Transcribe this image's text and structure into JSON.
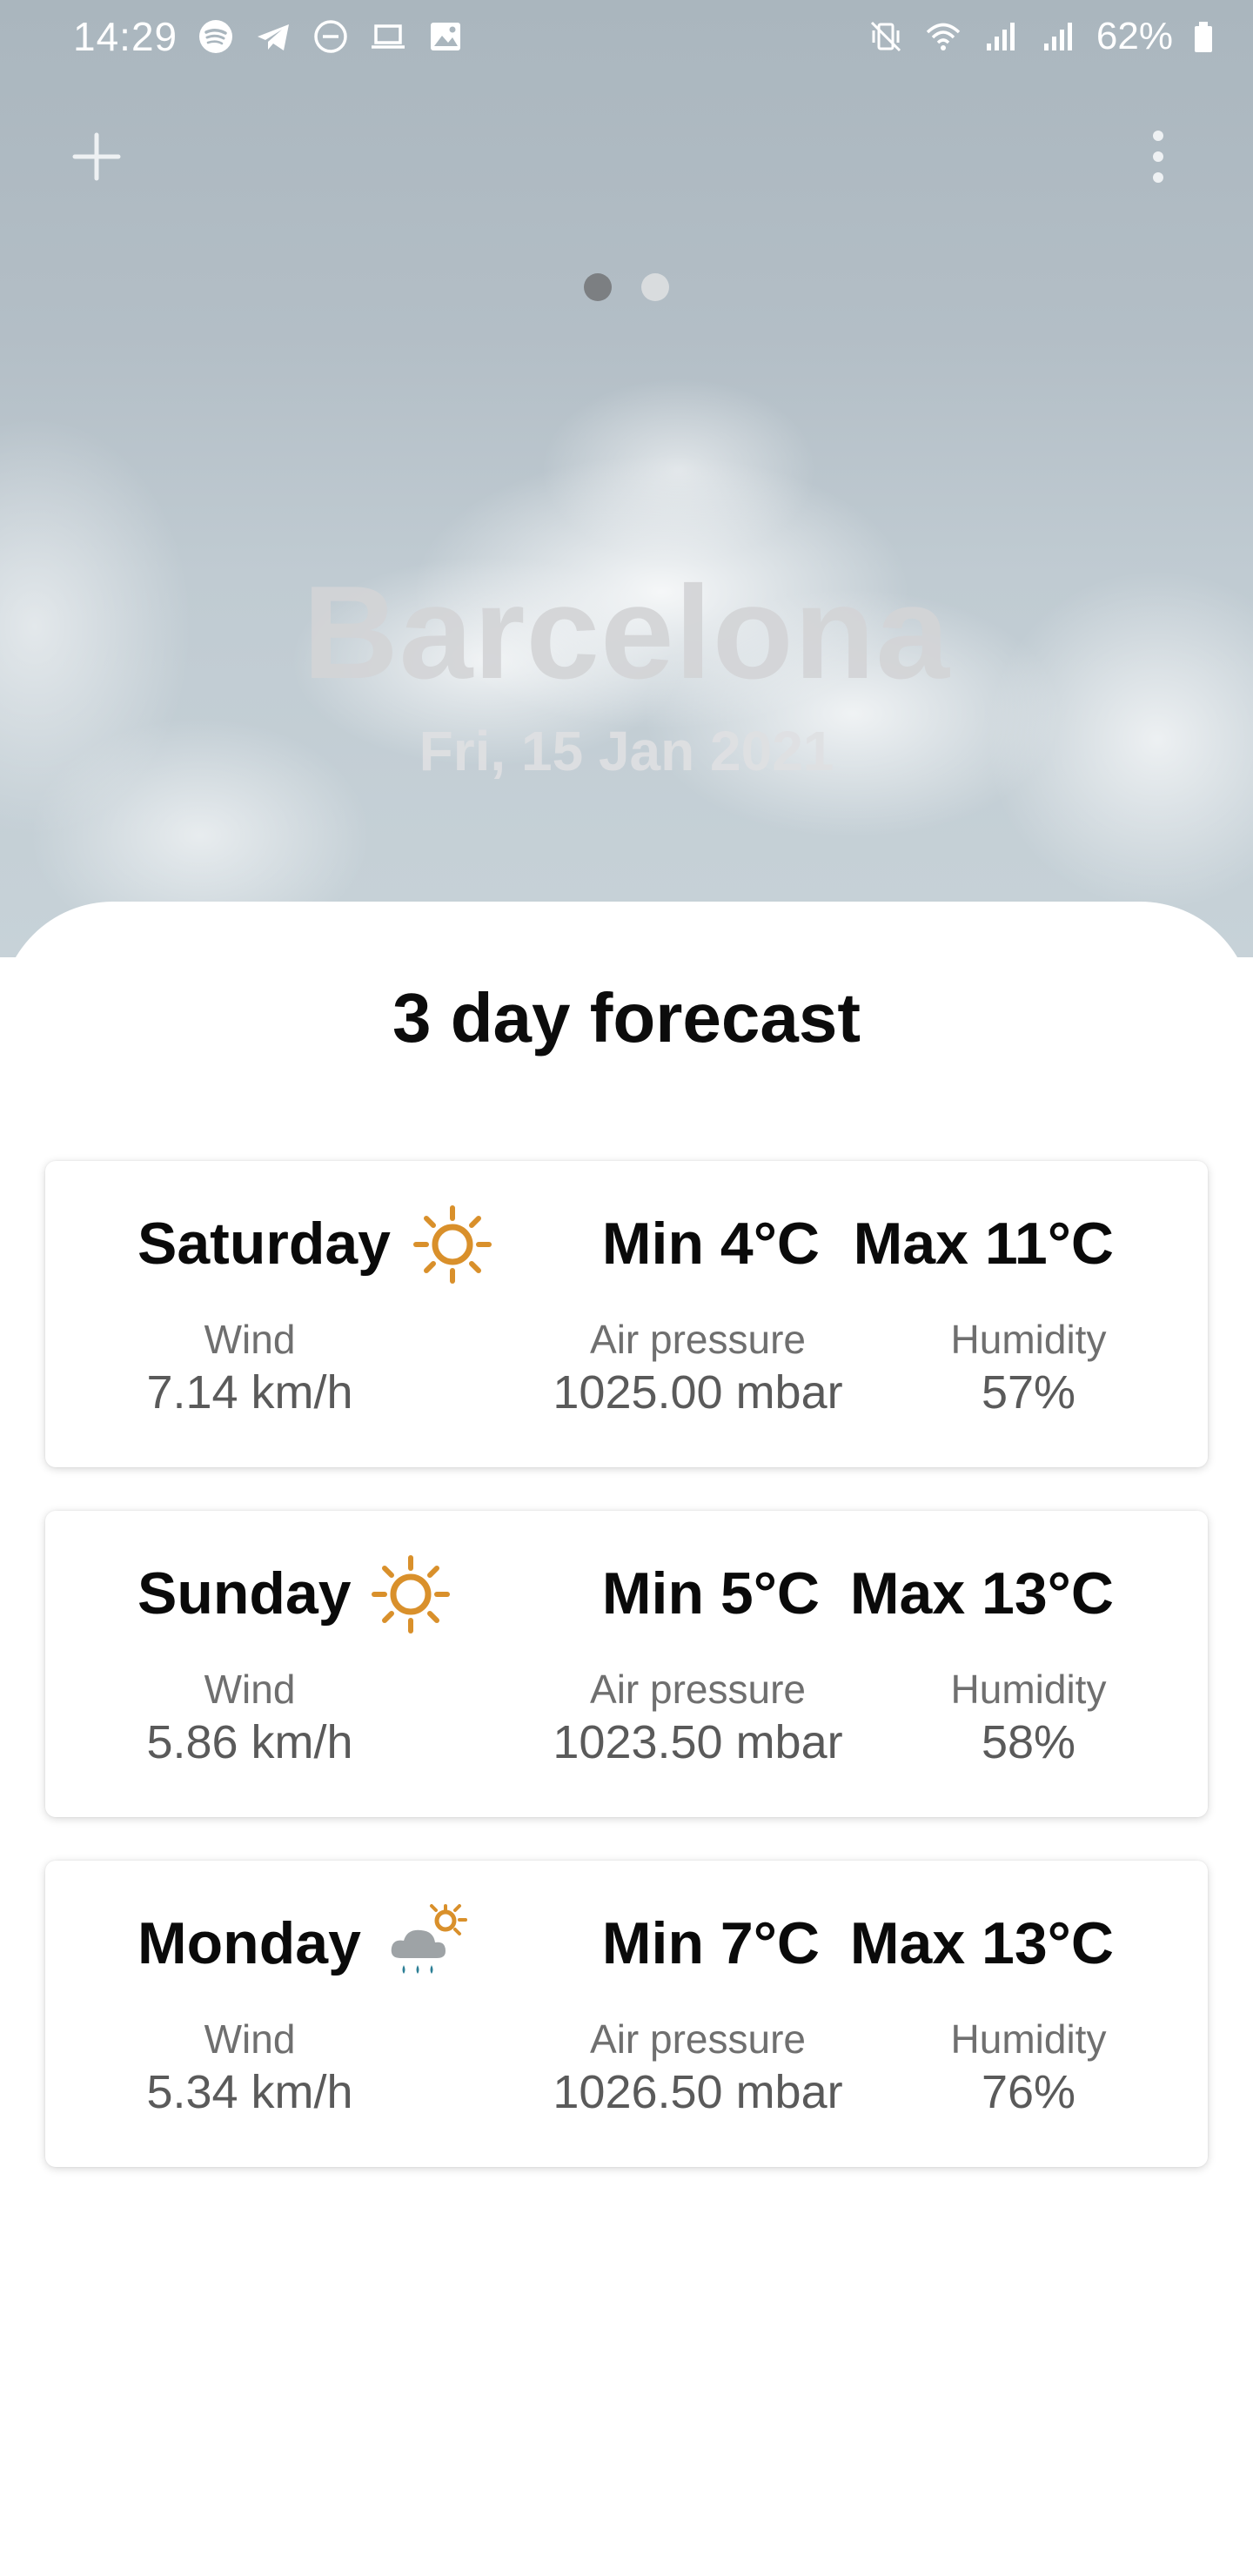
{
  "status_bar": {
    "time": "14:29",
    "battery": "62%"
  },
  "location": {
    "city": "Barcelona",
    "date": "Fri, 15 Jan 2021"
  },
  "pager": {
    "page_count": 2,
    "active_index": 0
  },
  "forecast": {
    "title": "3 day forecast",
    "days": [
      {
        "day": "Saturday",
        "icon": "sun-icon",
        "min": "Min 4°C",
        "max": "Max 11°C",
        "wind_label": "Wind",
        "wind_value": "7.14 km/h",
        "pressure_label": "Air pressure",
        "pressure_value": "1025.00 mbar",
        "humidity_label": "Humidity",
        "humidity_value": "57%"
      },
      {
        "day": "Sunday",
        "icon": "sun-icon",
        "min": "Min 5°C",
        "max": "Max 13°C",
        "wind_label": "Wind",
        "wind_value": "5.86 km/h",
        "pressure_label": "Air pressure",
        "pressure_value": "1023.50 mbar",
        "humidity_label": "Humidity",
        "humidity_value": "58%"
      },
      {
        "day": "Monday",
        "icon": "rain-cloud-sun-icon",
        "min": "Min 7°C",
        "max": "Max 13°C",
        "wind_label": "Wind",
        "wind_value": "5.34 km/h",
        "pressure_label": "Air pressure",
        "pressure_value": "1026.50 mbar",
        "humidity_label": "Humidity",
        "humidity_value": "76%"
      }
    ]
  },
  "colors": {
    "sun": "#d9902b",
    "rain": "#2b7e95",
    "cloud": "#9ea3a6"
  }
}
